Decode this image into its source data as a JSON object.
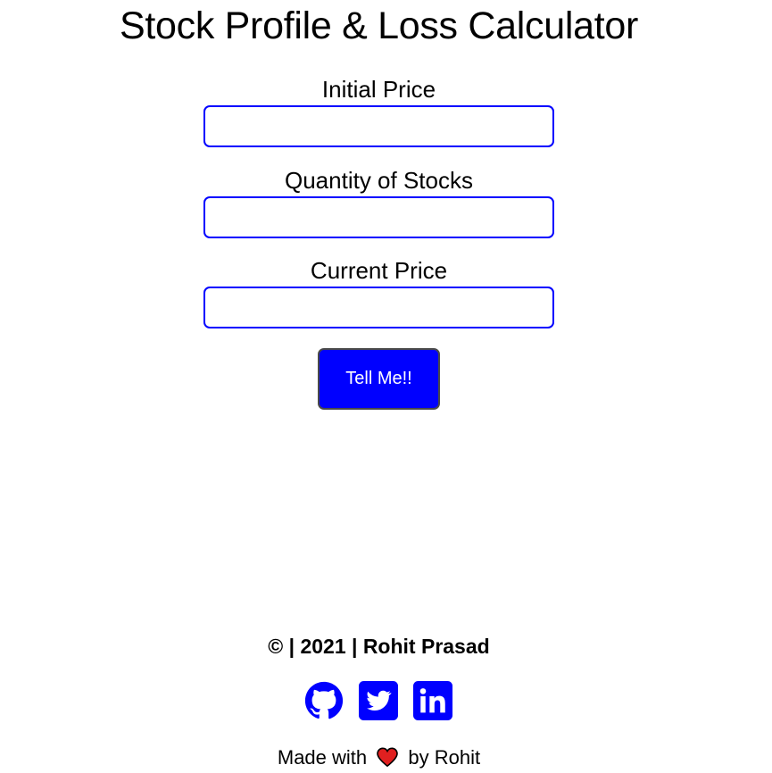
{
  "header": {
    "title": "Stock Profile & Loss Calculator"
  },
  "form": {
    "fields": [
      {
        "label": "Initial Price",
        "value": "",
        "placeholder": ""
      },
      {
        "label": "Quantity of Stocks",
        "value": "",
        "placeholder": ""
      },
      {
        "label": "Current Price",
        "value": "",
        "placeholder": ""
      }
    ],
    "submit_label": "Tell Me!!"
  },
  "footer": {
    "copyright": "© | 2021 | Rohit Prasad",
    "social_icons": [
      "github-icon",
      "twitter-icon",
      "linkedin-icon"
    ],
    "made_with_prefix": "Made with",
    "made_with_suffix": "by Rohit",
    "heart_icon": "heart-icon"
  },
  "colors": {
    "accent": "#0000ff",
    "heart": "#e02020",
    "text": "#000000",
    "background": "#ffffff"
  }
}
